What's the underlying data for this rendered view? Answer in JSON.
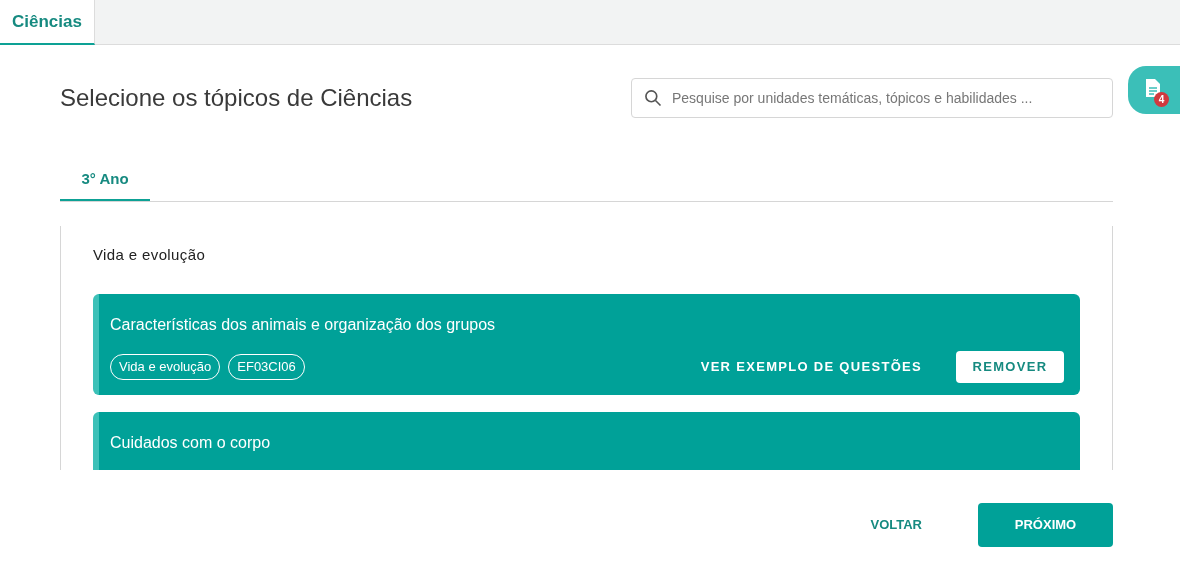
{
  "top_tabs": [
    {
      "label": "Ciências",
      "selected": true
    }
  ],
  "title": "Selecione os tópicos de Ciências",
  "search": {
    "placeholder": "Pesquise por unidades temáticas, tópicos e habilidades ..."
  },
  "side_button": {
    "badge": "4"
  },
  "year_tabs": [
    {
      "label": "3° Ano",
      "selected": true
    }
  ],
  "section": "Vida e evolução",
  "topics": [
    {
      "title": "Características dos animais e organização dos grupos",
      "tags": [
        "Vida e evolução",
        "EF03CI06"
      ],
      "link": "VER EXEMPLO DE QUESTÕES",
      "action": "REMOVER"
    },
    {
      "title": "Cuidados com o corpo"
    }
  ],
  "footer": {
    "back": "VOLTAR",
    "next": "PRÓXIMO"
  }
}
